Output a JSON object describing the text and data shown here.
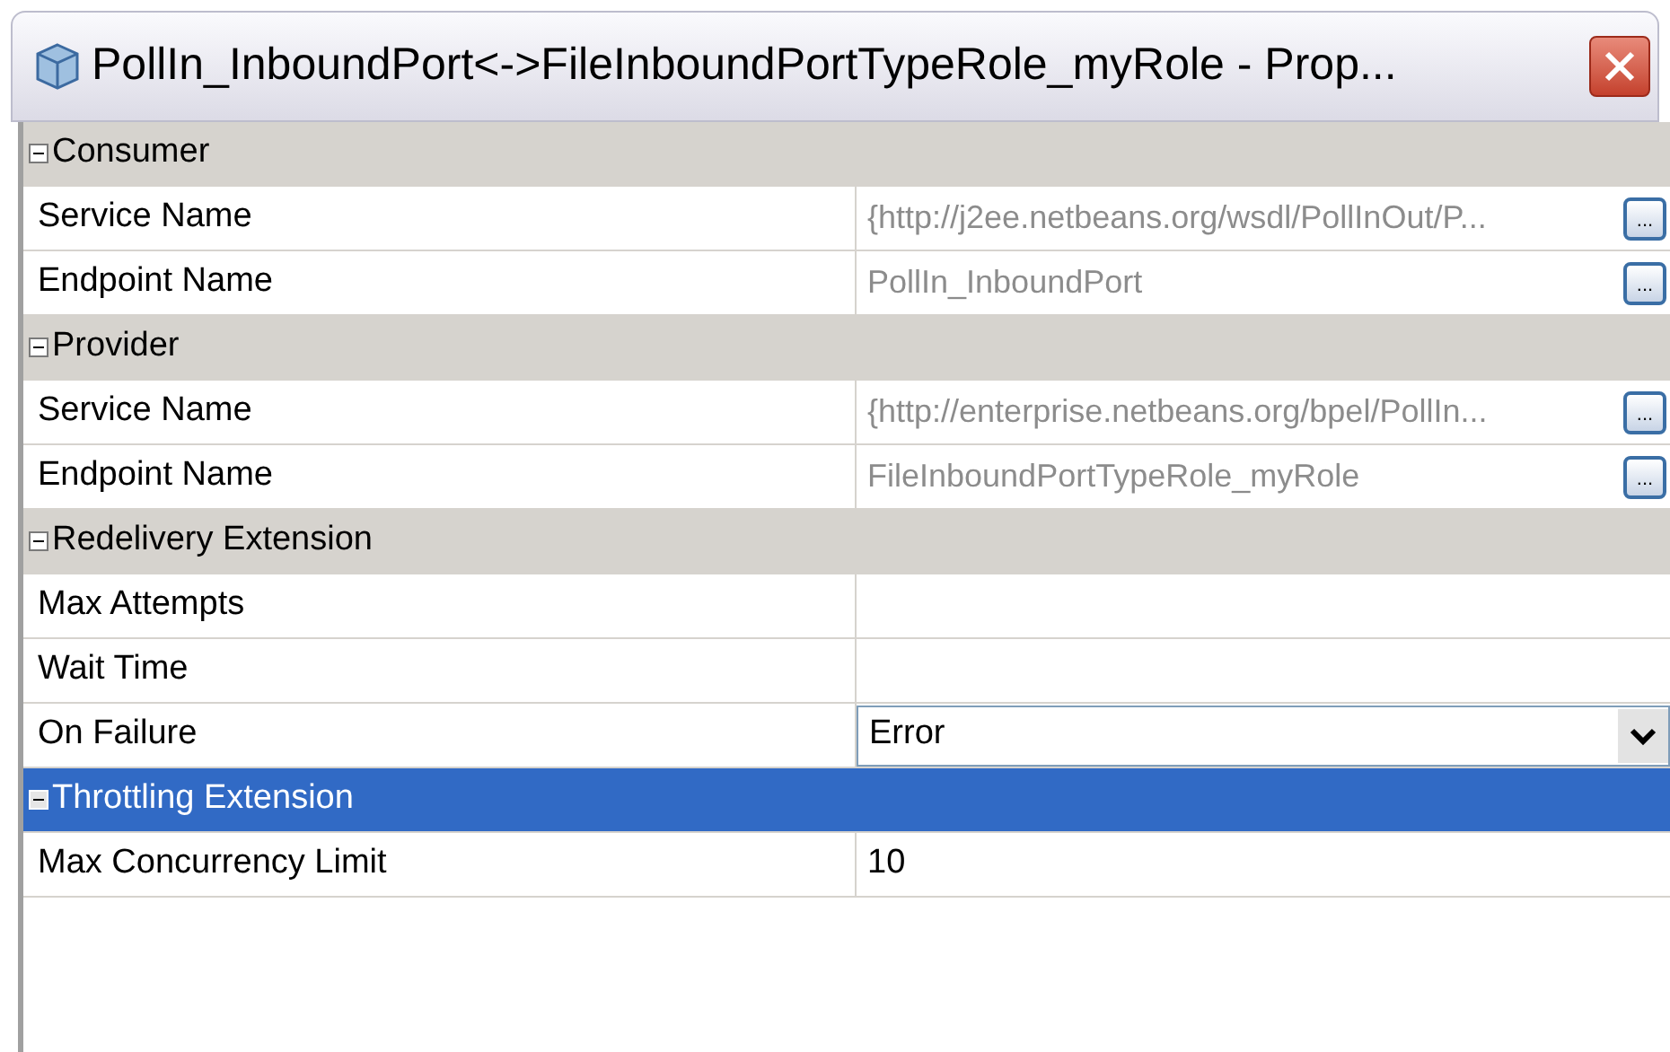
{
  "window": {
    "title": "PollIn_InboundPort<->FileInboundPortTypeRole_myRole - Prop..."
  },
  "sections": [
    {
      "name": "Consumer",
      "expanded": true,
      "selected": false,
      "properties": [
        {
          "name": "Service Name",
          "kind": "readonly",
          "value": "{http://j2ee.netbeans.org/wsdl/PollInOut/P...",
          "button": "..."
        },
        {
          "name": "Endpoint Name",
          "kind": "readonly",
          "value": "PollIn_InboundPort",
          "button": "..."
        }
      ]
    },
    {
      "name": "Provider",
      "expanded": true,
      "selected": false,
      "properties": [
        {
          "name": "Service Name",
          "kind": "readonly",
          "value": "{http://enterprise.netbeans.org/bpel/PollIn...",
          "button": "..."
        },
        {
          "name": "Endpoint Name",
          "kind": "readonly",
          "value": "FileInboundPortTypeRole_myRole",
          "button": "..."
        }
      ]
    },
    {
      "name": "Redelivery Extension",
      "expanded": true,
      "selected": false,
      "properties": [
        {
          "name": "Max Attempts",
          "kind": "text"
        },
        {
          "name": "Wait Time",
          "kind": "text"
        },
        {
          "name": "On Failure",
          "kind": "combo",
          "value": "Error"
        }
      ]
    },
    {
      "name": "Throttling Extension",
      "expanded": true,
      "selected": true,
      "properties": [
        {
          "name": "Max Concurrency Limit",
          "kind": "text",
          "value": "10"
        }
      ]
    }
  ]
}
